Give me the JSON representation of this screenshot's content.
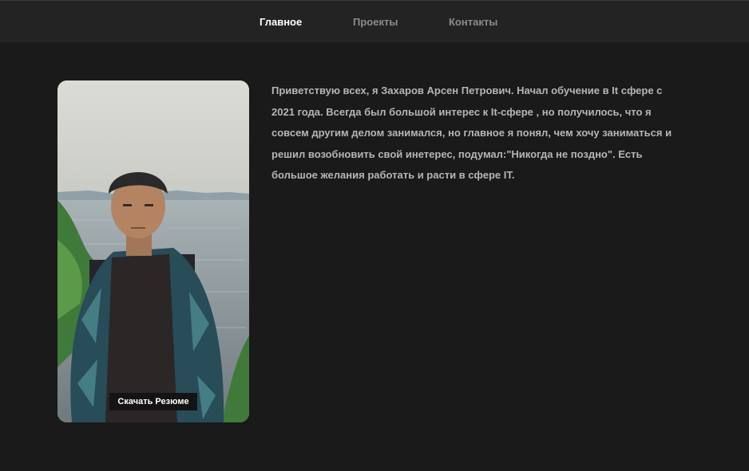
{
  "nav": {
    "items": [
      {
        "label": "Главное",
        "active": true
      },
      {
        "label": "Проекты",
        "active": false
      },
      {
        "label": "Контакты",
        "active": false
      }
    ]
  },
  "profile": {
    "photo_icon": "portrait-photo",
    "resume_button_label": "Скачать Резюме"
  },
  "bio": {
    "text": "Приветствую всех, я Захаров Арсен Петрович. Начал обучение в It сфере с 2021 года. Всегда был большой интерес к It-сфере , но получилось, что я совсем другим делом занимался, но главное я понял, чем хочу заниматься и решил возобновить свой инетерес, подумал:\"Никогда не поздно\". Есть большое желания работать и расти в сфере IT."
  },
  "colors": {
    "background": "#1a1a1a",
    "navbar": "#232323",
    "nav_active": "#ffffff",
    "nav_inactive": "#8b8b8b",
    "text": "#b5b5b5"
  }
}
